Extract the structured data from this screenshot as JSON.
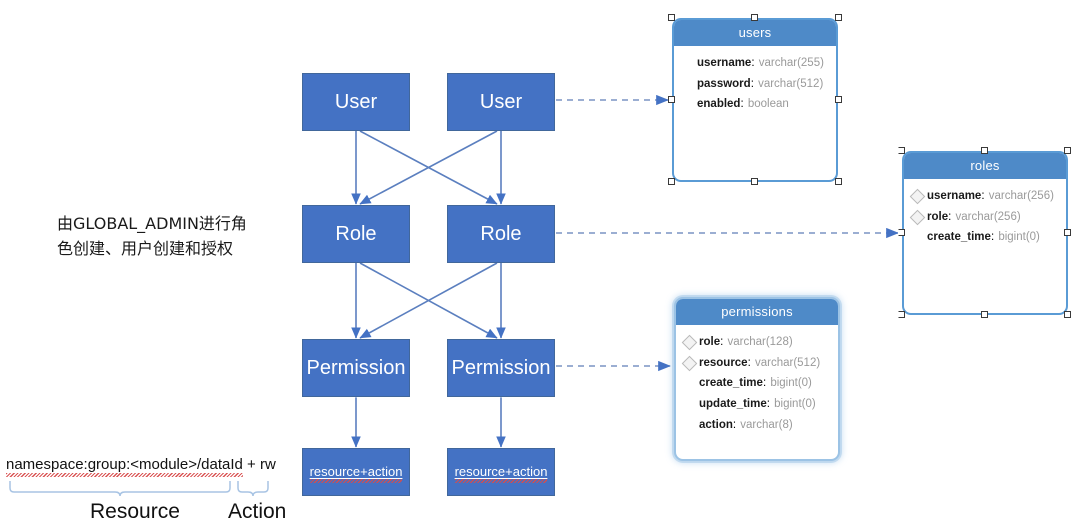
{
  "diagram": {
    "title": "RBAC permission model diagram",
    "colors": {
      "box_fill": "#4472C4",
      "box_text": "#FFFFFF",
      "table_header": "#4E8AC8",
      "connector": "#5B7FBF",
      "selection_border": "#5A9BD5",
      "bracket": "#A8C4E4",
      "spellcheck_underline": "#D84C4C"
    },
    "note": "由GLOBAL_ADMIN进行角\n色创建、用户创建和授权",
    "flow": {
      "columns": [
        {
          "id": "left",
          "nodes": [
            {
              "id": "user-left",
              "label": "User"
            },
            {
              "id": "role-left",
              "label": "Role"
            },
            {
              "id": "permission-left",
              "label": "Permission"
            },
            {
              "id": "resource-action-left",
              "label": "resource+action"
            }
          ]
        },
        {
          "id": "right",
          "nodes": [
            {
              "id": "user-right",
              "label": "User"
            },
            {
              "id": "role-right",
              "label": "Role"
            },
            {
              "id": "permission-right",
              "label": "Permission"
            },
            {
              "id": "resource-action-right",
              "label": "resource+action"
            }
          ]
        }
      ]
    },
    "annotation": {
      "formula_parts": {
        "resource_main": "namespace:group:<module>",
        "resource_tail": "/dataId",
        "plus": " + ",
        "action": "rw"
      },
      "formula_full": "namespace:group:<module>/dataId + rw",
      "bracket_labels": {
        "resource": "Resource",
        "action": "Action"
      }
    },
    "tables": [
      {
        "id": "users",
        "name": "users",
        "selected": true,
        "fields": [
          {
            "name": "username",
            "type": "varchar(255)",
            "key": false
          },
          {
            "name": "password",
            "type": "varchar(512)",
            "key": false
          },
          {
            "name": "enabled",
            "type": "boolean",
            "key": false
          }
        ]
      },
      {
        "id": "roles",
        "name": "roles",
        "selected": true,
        "fields": [
          {
            "name": "username",
            "type": "varchar(256)",
            "key": true
          },
          {
            "name": "role",
            "type": "varchar(256)",
            "key": true
          },
          {
            "name": "create_time",
            "type": "bigint(0)",
            "key": false
          }
        ]
      },
      {
        "id": "permissions",
        "name": "permissions",
        "selected": false,
        "fields": [
          {
            "name": "role",
            "type": "varchar(128)",
            "key": true
          },
          {
            "name": "resource",
            "type": "varchar(512)",
            "key": true
          },
          {
            "name": "create_time",
            "type": "bigint(0)",
            "key": false
          },
          {
            "name": "update_time",
            "type": "bigint(0)",
            "key": false
          },
          {
            "name": "action",
            "type": "varchar(8)",
            "key": false
          }
        ]
      }
    ]
  }
}
